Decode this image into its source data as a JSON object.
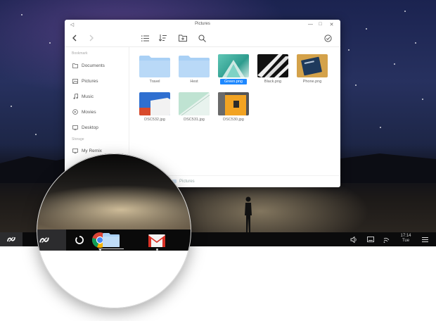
{
  "window": {
    "title": "Pictures",
    "controls": {
      "back": "◁",
      "minimize": "—",
      "maximize": "□",
      "close": "✕"
    }
  },
  "sidebar": {
    "bookmark_title": "Bookmark",
    "storage_title": "Storage",
    "bookmarks": [
      {
        "label": "Documents",
        "icon": "document-icon"
      },
      {
        "label": "Pictures",
        "icon": "picture-icon"
      },
      {
        "label": "Music",
        "icon": "music-icon"
      },
      {
        "label": "Movies",
        "icon": "movie-icon"
      },
      {
        "label": "Desktop",
        "icon": "desktop-icon"
      }
    ],
    "storage": [
      {
        "label": "My Remix",
        "icon": "computer-icon"
      }
    ]
  },
  "files": [
    {
      "name": "Travel",
      "kind": "folder",
      "selected": false
    },
    {
      "name": "Hest",
      "kind": "folder",
      "selected": false
    },
    {
      "name": "Green.png",
      "kind": "image",
      "selected": true
    },
    {
      "name": "Black.png",
      "kind": "image",
      "selected": false
    },
    {
      "name": "Phone.png",
      "kind": "image",
      "selected": false
    },
    {
      "name": "DSC532.jpg",
      "kind": "image",
      "selected": false
    },
    {
      "name": "DSC531.jpg",
      "kind": "image",
      "selected": false
    },
    {
      "name": "DSC530.jpg",
      "kind": "image",
      "selected": false
    }
  ],
  "statusbar": {
    "path": "Pictures"
  },
  "shelf": {
    "clock_time": "17:14",
    "clock_day": "Tue",
    "icons": [
      "remix-logo-icon",
      "launcher-icon",
      "chrome-icon",
      "files-icon",
      "gmail-icon",
      "volume-icon",
      "keyboard-icon",
      "wifi-icon",
      "menu-icon"
    ]
  },
  "colors": {
    "folder": "#a9d0f5",
    "selection": "#1e88ff",
    "shelf": "#0b0b0c"
  }
}
